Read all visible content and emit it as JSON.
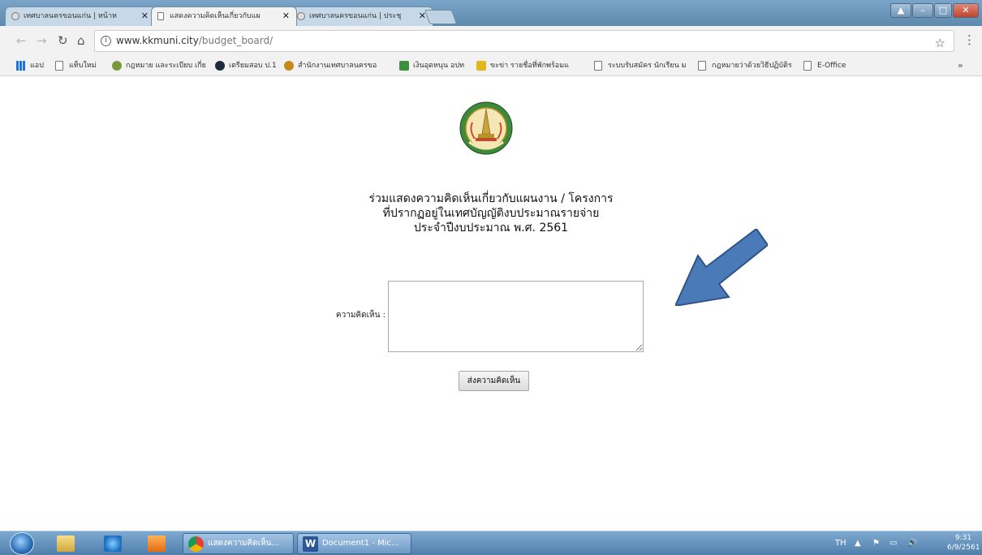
{
  "browser": {
    "tabs": [
      {
        "title": "เทศบาลนครขอนแก่น | หน้าห"
      },
      {
        "title": "แสดงความคิดเห็นเกี่ยวกับแผ"
      },
      {
        "title": "เทศบาลนครขอนแก่น | ประชุ"
      }
    ],
    "url_host": "www.kkmuni.city",
    "url_path": "/budget_board/",
    "bookmarks": [
      {
        "label": "แอป",
        "icon": "apps-icon"
      },
      {
        "label": "แท็บใหม่",
        "icon": "page-icon"
      },
      {
        "label": "กฎหมาย และระเบียบ เกี่ย",
        "icon": "law-site-icon"
      },
      {
        "label": "เตรียมสอบ ป.1",
        "icon": "k-site-icon"
      },
      {
        "label": "สำนักงานเทศบาลนครขอ",
        "icon": "municipal-seal-icon"
      },
      {
        "label": "เงินอุดหนุน อปท",
        "icon": "fund-site-icon"
      },
      {
        "label": "ขะข่า รายชื่อที่พักพร้อมแ",
        "icon": "folder-site-icon"
      },
      {
        "label": "ระบบรับสมัคร นักเรียน ม",
        "icon": "page-icon"
      },
      {
        "label": "กฎหมายว่าด้วยวิธีปฏิบัติร",
        "icon": "page-icon"
      },
      {
        "label": "E-Office",
        "icon": "page-icon"
      }
    ],
    "bookmark_more": "»"
  },
  "page": {
    "heading_line1": "ร่วมแสดงความคิดเห็นเกี่ยวกับแผนงาน / โครงการ",
    "heading_line2": "ที่ปรากฏอยู่ในเทศบัญญัติงบประมาณรายจ่าย",
    "heading_line3": "ประจำปีงบประมาณ พ.ศ. 2561",
    "comment_label": "ความคิดเห็น :",
    "comment_value": "",
    "submit_label": "ส่งความคิดเห็น",
    "arrow_color": "#4a7ab8"
  },
  "taskbar": {
    "buttons": [
      {
        "label": "แสดงความคิดเห็น..."
      },
      {
        "label": "Document1 - Mic..."
      }
    ],
    "language": "TH",
    "time": "9:31",
    "date": "6/9/2561"
  }
}
